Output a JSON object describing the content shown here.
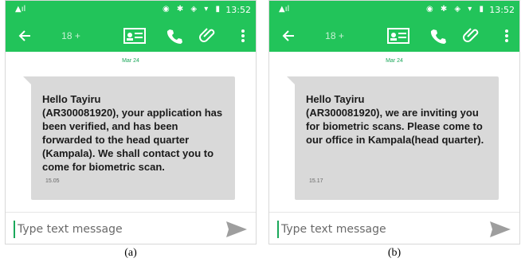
{
  "accent_color": "#22c45a",
  "panels": [
    {
      "status_time": "13:52",
      "contact_number": "18 +",
      "date": "Mar 24",
      "message": "Hello Tayiru\n(AR300081920), your application has been verified, and has been forwarded to the head quarter (Kampala). We shall contact you to come for biometric scan.",
      "message_time": "15.05",
      "input_placeholder": "Type text message",
      "caption": "(a)"
    },
    {
      "status_time": "13:52",
      "contact_number": "18 +",
      "date": "Mar 24",
      "message": "Hello Tayiru\n(AR300081920), we are inviting you for biometric scans. Please come to our office in Kampala(head quarter).",
      "message_time": "15.17",
      "input_placeholder": "Type text message",
      "caption": "(b)"
    }
  ],
  "icons": [
    "back-arrow-icon",
    "contact-card-icon",
    "phone-icon",
    "paperclip-icon",
    "more-vert-icon",
    "send-icon"
  ]
}
